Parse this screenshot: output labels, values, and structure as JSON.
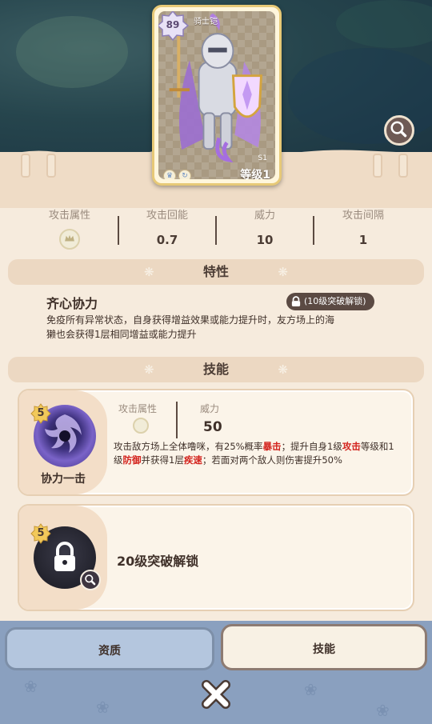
{
  "card": {
    "level_badge": "89",
    "name": "骑士铠",
    "grade": "S1",
    "level_label": "等级1"
  },
  "stats": [
    {
      "label": "攻击属性",
      "value": ""
    },
    {
      "label": "攻击回能",
      "value": "0.7"
    },
    {
      "label": "威力",
      "value": "10"
    },
    {
      "label": "攻击间隔",
      "value": "1"
    }
  ],
  "trait_section": {
    "title": "特性",
    "name": "齐心协力",
    "lock_label": "(10级突破解锁)",
    "desc_line1": "免疫所有异常状态，自身获得增益效果或能力提升时，友方场上的海",
    "desc_line2": "獭也会获得1层相同增益或能力提升"
  },
  "skill_section": {
    "title": "技能",
    "skills": [
      {
        "badge": "5",
        "name": "协力一击",
        "attr_label": "攻击属性",
        "power_label": "威力",
        "power_value": "50",
        "desc": {
          "a": "攻击敌方场上全体噜咪，有25%概率",
          "b": "暴击",
          "c": "；提升自身1级",
          "d": "攻击",
          "e": "等级和1级",
          "f": "防御",
          "g": "并获得1层",
          "h": "疾速",
          "i": "；若面对两个敌人则伤害提升50%"
        }
      },
      {
        "badge": "5",
        "locked_text": "20级突破解锁"
      }
    ]
  },
  "tabs": {
    "left": "资质",
    "right": "技能"
  },
  "colors": {
    "accent_red": "#d3231d",
    "panel_beige": "#ecd8c2",
    "bottom_blue": "#8aa0bf"
  }
}
